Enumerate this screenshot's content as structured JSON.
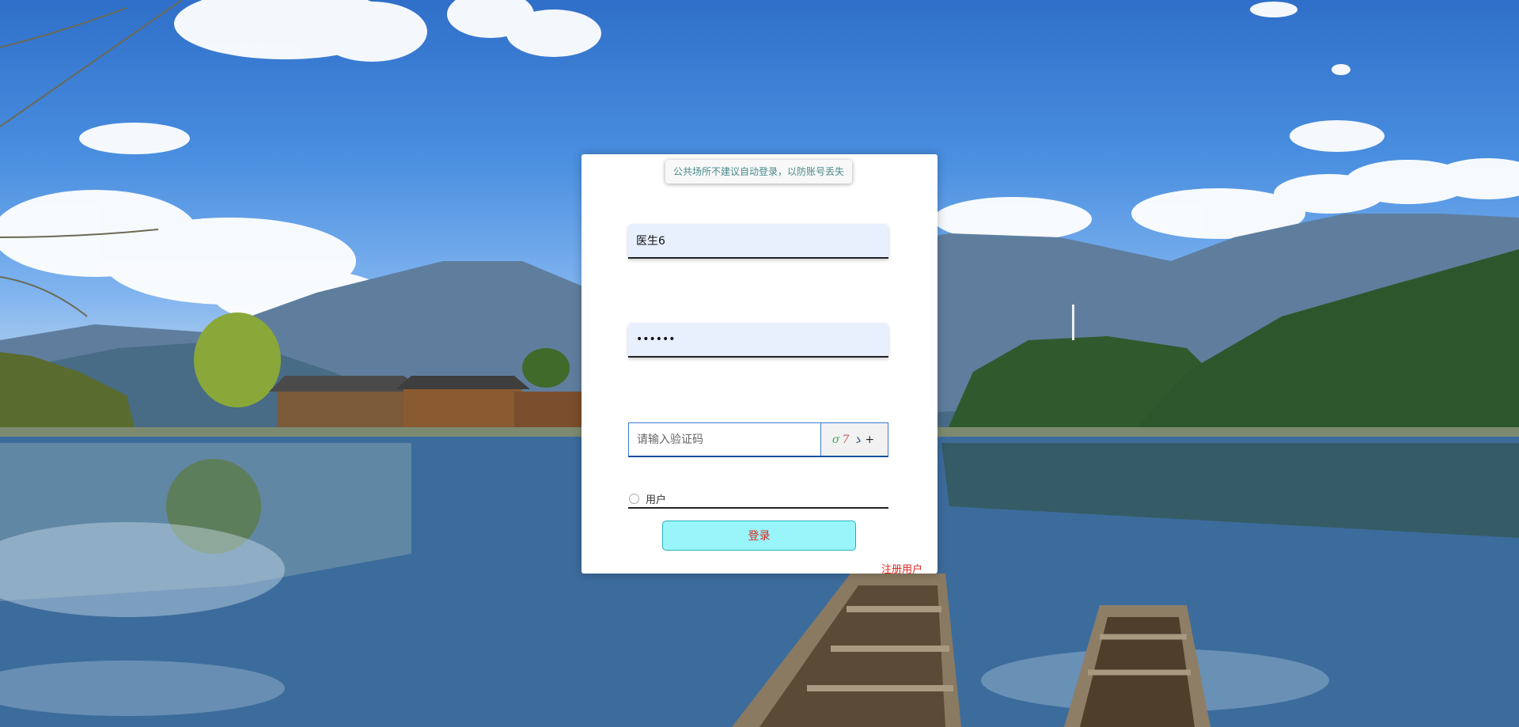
{
  "login": {
    "tip": "公共场所不建议自动登录，以防账号丢失",
    "username_value": "医生6",
    "password_value": "••••••",
    "captcha_placeholder": "请输入验证码",
    "captcha_text": [
      "σ",
      "7",
      "ゝ",
      "+"
    ],
    "role_label": "用户",
    "submit_label": "登录",
    "register_link": "注册用户"
  }
}
